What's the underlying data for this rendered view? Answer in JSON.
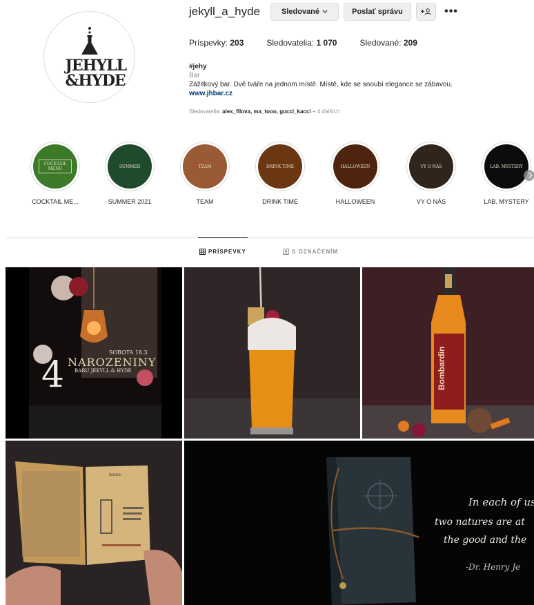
{
  "profile": {
    "avatar_logo": "JEHYLL &HYDE",
    "username": "jekyll_a_hyde",
    "following_button": "Sledované",
    "message_button": "Poslať správu",
    "add_user_label": "+",
    "more_label": "•••",
    "stats": {
      "posts_label": "Príspevky:",
      "posts_value": "203",
      "followers_label": "Sledovatelia:",
      "followers_value": "1 070",
      "following_label": "Sledované:",
      "following_value": "209"
    },
    "bio": {
      "name": "#jehy",
      "category": "Bar",
      "text": "Zážitkový bar. Dvě tváře na jednom místě. Místě, kde se snoubí elegance se zábavou.",
      "link": "www.jhbar.cz"
    },
    "followed_by": {
      "prefix": "Sledovatelia:",
      "names": "alex_filova, ma_tooo, gucci_kacci",
      "more": "+ 4 ďalších"
    }
  },
  "highlights": [
    {
      "label": "COCKTAIL ME...",
      "cover_text": "COCKTAIL MENU",
      "color": "#3c7a2a"
    },
    {
      "label": "SUMMER 2021",
      "cover_text": "SUMMER",
      "color": "#1f4a2c"
    },
    {
      "label": "TEAM",
      "cover_text": "TEAM",
      "color": "#9a5a35"
    },
    {
      "label": "DRINK TIME",
      "cover_text": "DRINK TIME",
      "color": "#6b3612"
    },
    {
      "label": "HALLOWEEN",
      "cover_text": "HALLOWEEN",
      "color": "#4e2410"
    },
    {
      "label": "VY O NÁS",
      "cover_text": "VY O NÁS",
      "color": "#30241d"
    },
    {
      "label": "LAB. MYSTERY",
      "cover_text": "LAB. MYSTERY",
      "color": "#0c0c0c"
    }
  ],
  "tabs": {
    "posts": "PRÍSPEVKY",
    "tagged": "S OZNAČENÍM"
  },
  "posts": {
    "post1": {
      "line1": "SOBOTA 18.3",
      "line2": "NAROZENINY",
      "line3": "BARU JEKYLL & HYDE",
      "number": "4"
    },
    "post3": {
      "bottle_text": "Bombardin"
    },
    "post4": {
      "menu_text": "menu"
    },
    "post5": {
      "quote1": "In each of us",
      "quote2": "two natures are at",
      "quote3": "the good and the",
      "quote4": "-Dr. Henry Je"
    }
  }
}
